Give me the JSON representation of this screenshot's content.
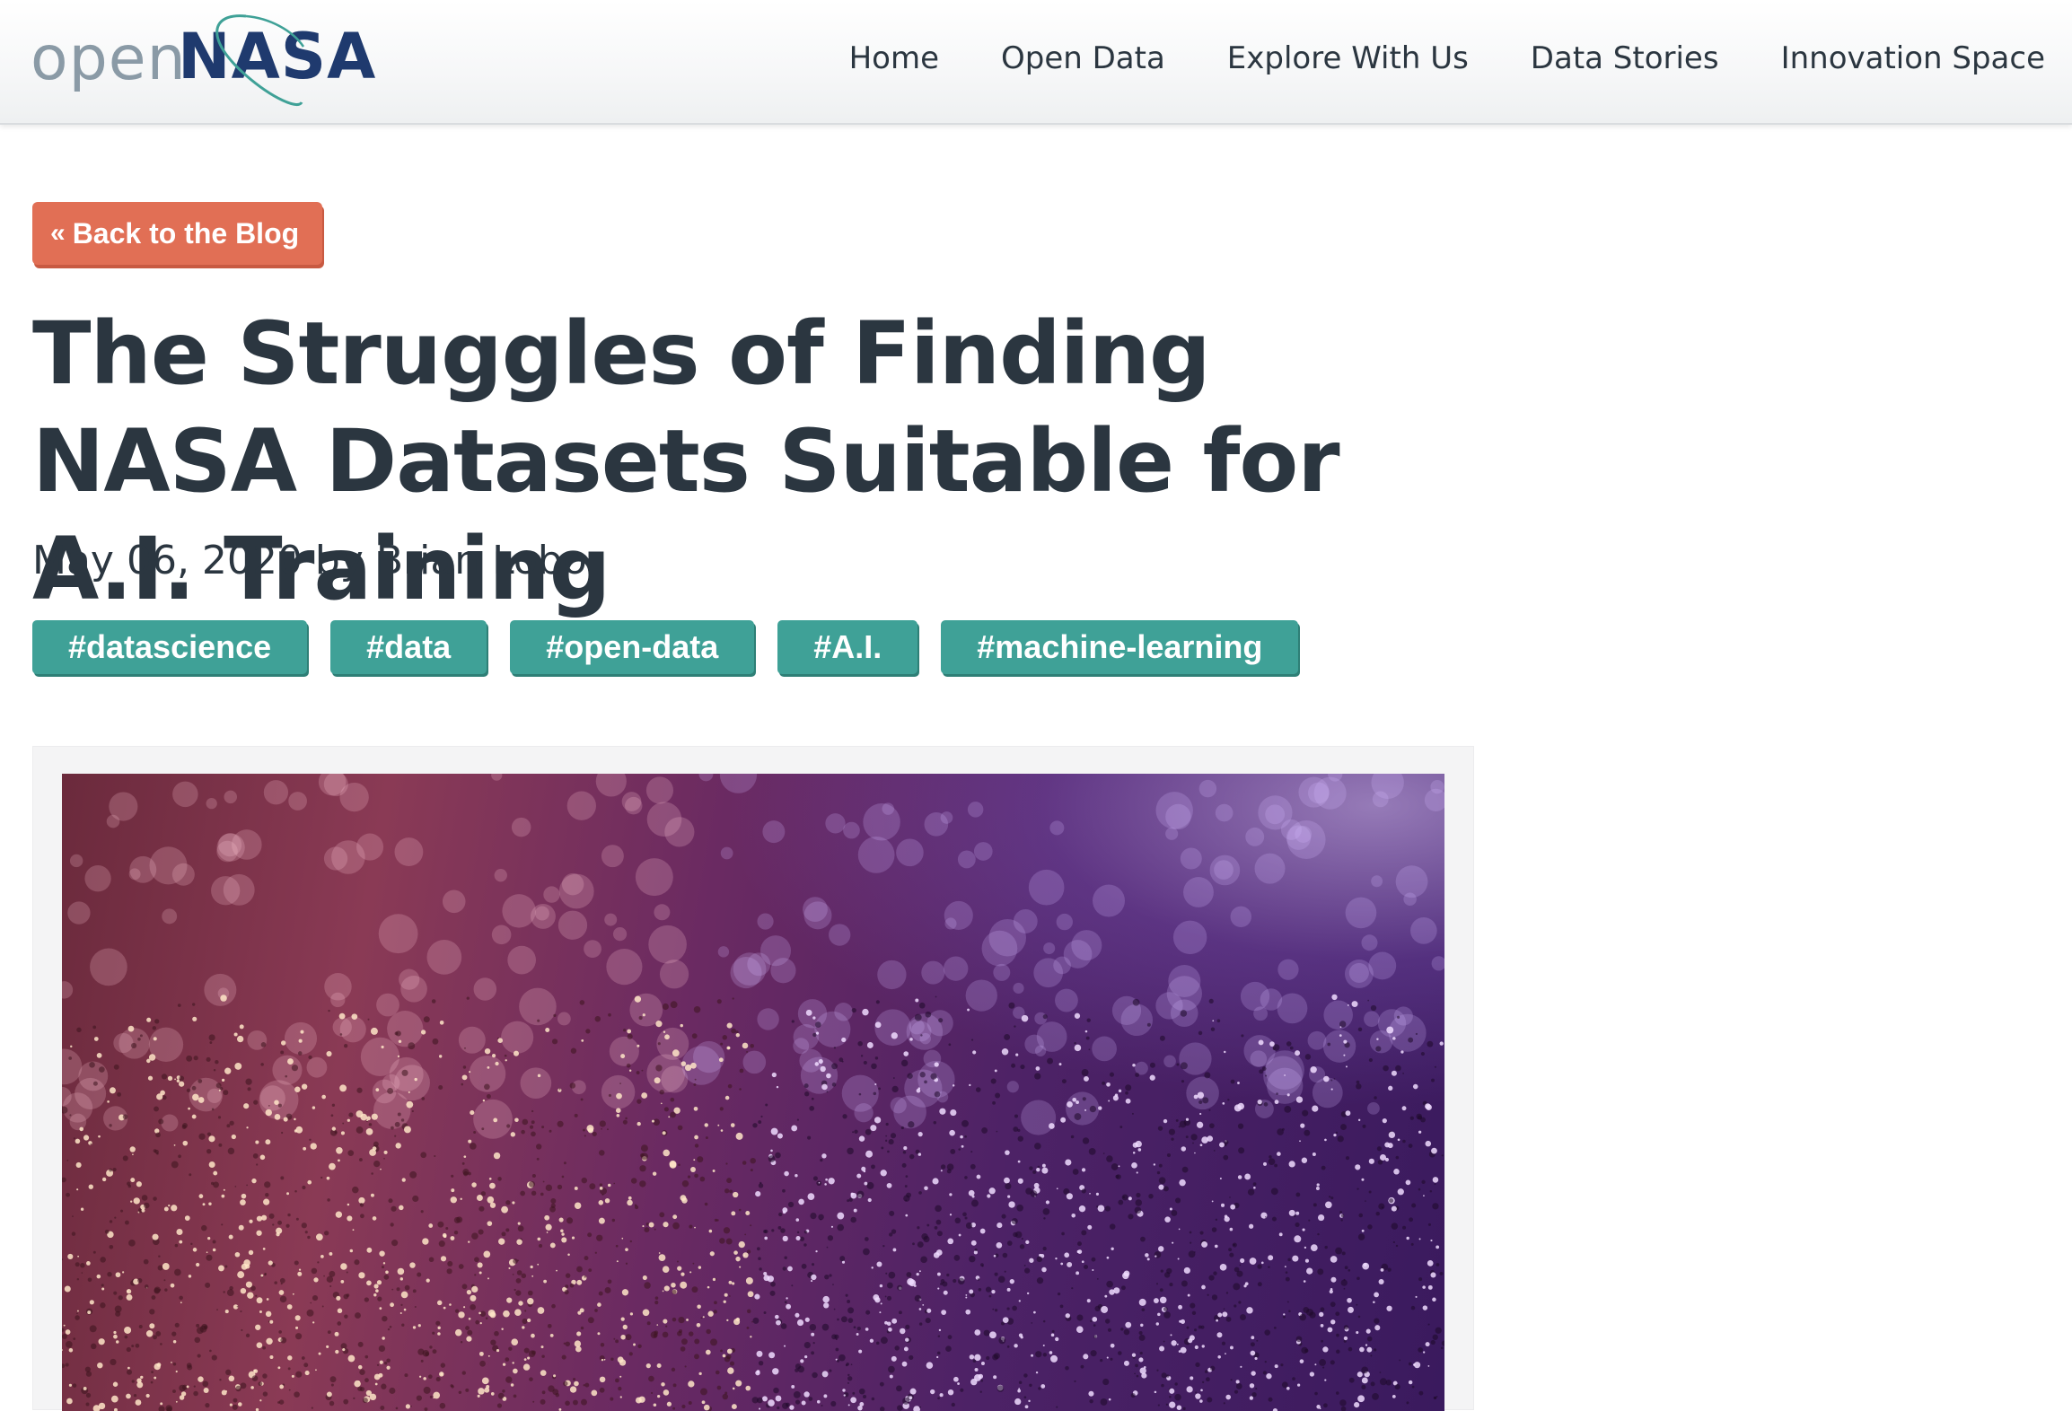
{
  "header": {
    "logo": {
      "open": "open",
      "nasa": "NASA"
    },
    "nav": [
      {
        "label": "Home"
      },
      {
        "label": "Open Data"
      },
      {
        "label": "Explore With Us"
      },
      {
        "label": "Data Stories"
      },
      {
        "label": "Innovation Space"
      }
    ]
  },
  "post": {
    "back_label": "Back to the Blog",
    "title": "The Struggles of Finding NASA Datasets Suitable for A.I. Training",
    "meta": "May 06, 2020 by Brian Lobo",
    "tags": [
      {
        "label": "#datascience"
      },
      {
        "label": "#data"
      },
      {
        "label": "#open-data"
      },
      {
        "label": "#A.I."
      },
      {
        "label": "#machine-learning"
      }
    ]
  },
  "colors": {
    "accent_orange": "#e16f55",
    "tag_teal": "#3fa197",
    "logo_navy": "#1f3a6e",
    "text_dark": "#2b3640"
  },
  "icons": {
    "back": "double-chevron-left-icon",
    "logo_orbit": "orbit-swoosh-icon"
  }
}
